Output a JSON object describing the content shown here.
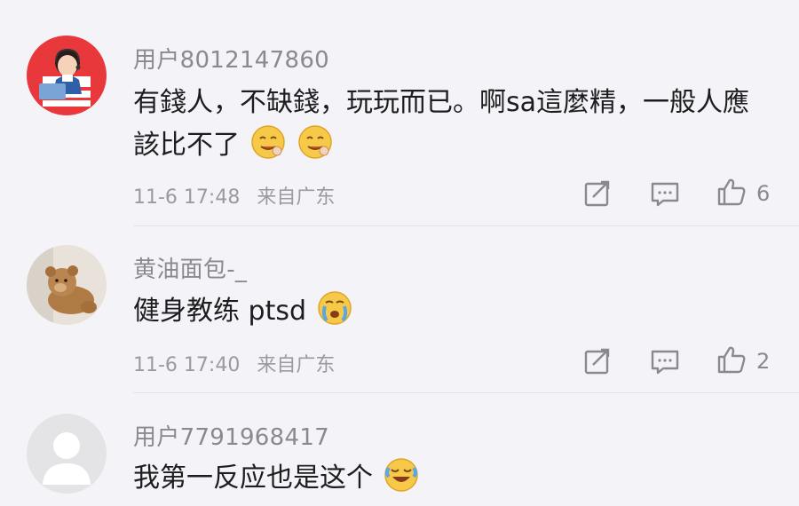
{
  "comments": [
    {
      "username": "用户8012147860",
      "avatar": "customer-service-avatar",
      "text": "有錢人，不缺錢，玩玩而已。啊sa這麼精，一般人應該比不了",
      "emojis": [
        "drooling-emoji",
        "drooling-emoji"
      ],
      "time": "11-6 17:48",
      "location": "来自广东",
      "likes": "6"
    },
    {
      "username": "黄油面包-_",
      "avatar": "teddy-bear-avatar",
      "text": "健身教练 ptsd",
      "emojis": [
        "crying-emoji"
      ],
      "time": "11-6 17:40",
      "location": "来自广东",
      "likes": "2"
    },
    {
      "username": "用户7791968417",
      "avatar": "default-user-avatar",
      "text": "我第一反应也是这个",
      "emojis": [
        "laughing-crying-emoji"
      ]
    }
  ],
  "colors": {
    "background": "#f4f3f8",
    "username": "#8a8a8e",
    "icon": "#8a8a8e"
  }
}
